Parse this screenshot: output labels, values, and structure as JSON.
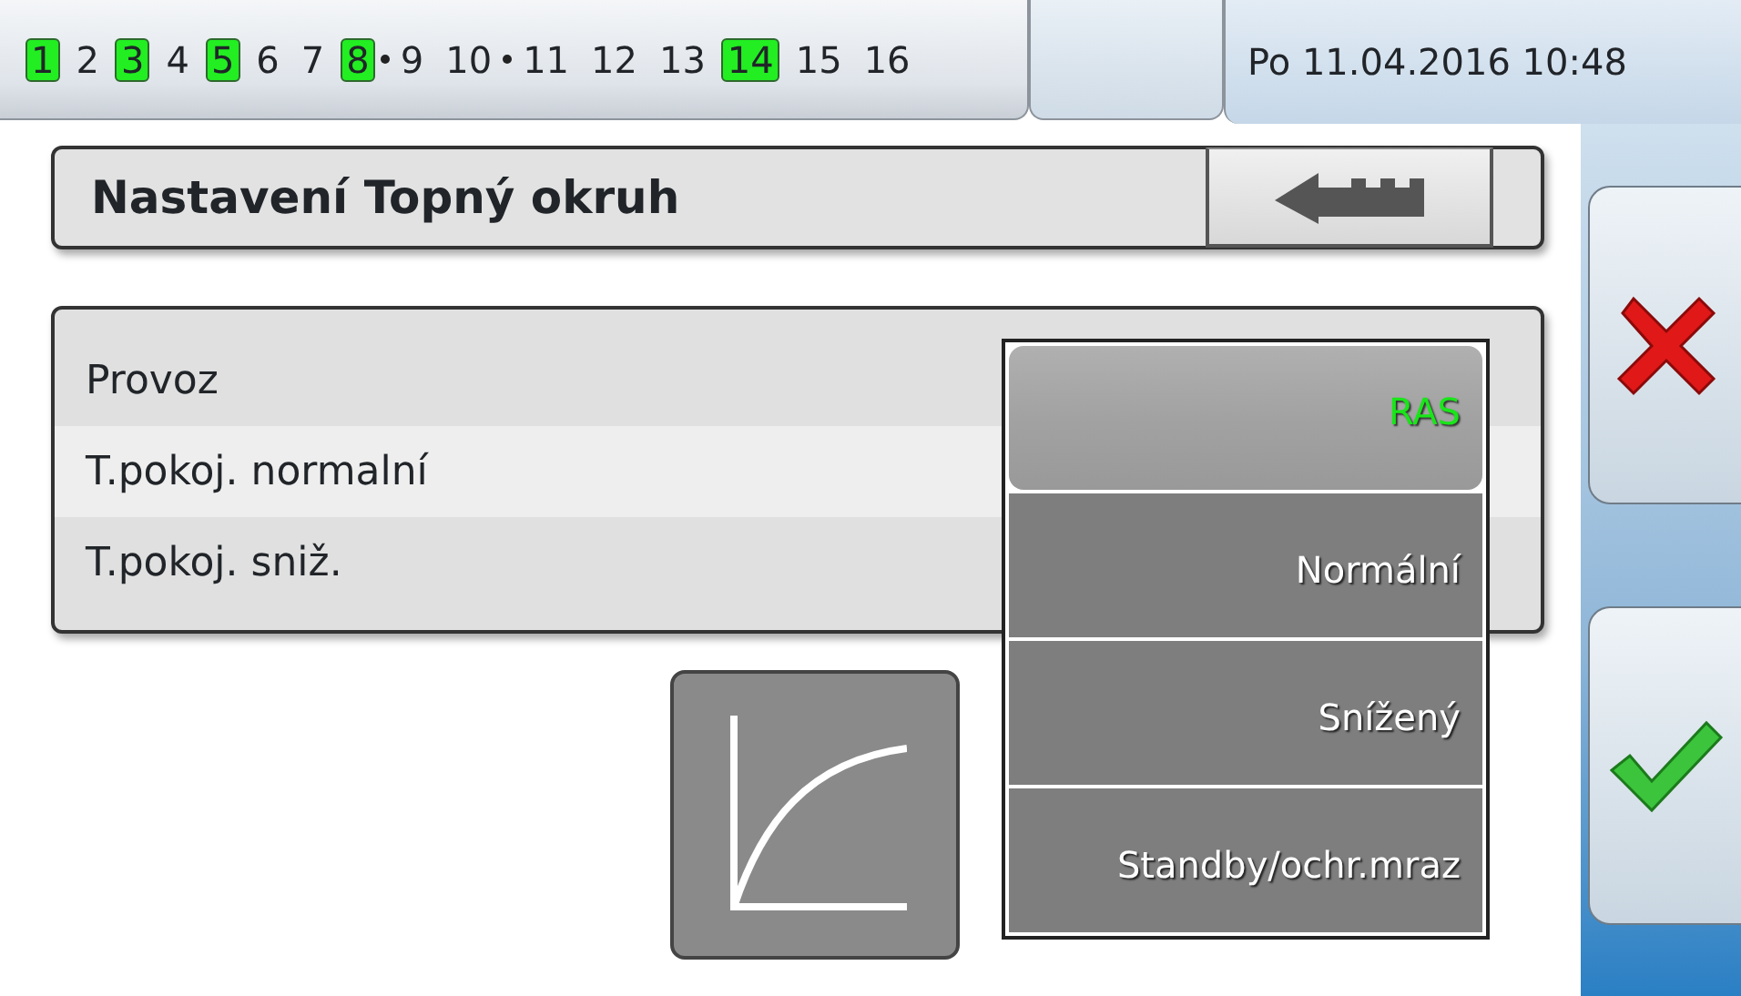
{
  "status_bar": {
    "outputs": [
      {
        "label": "1",
        "active": true,
        "link_next": false
      },
      {
        "label": "2",
        "active": false,
        "link_next": false
      },
      {
        "label": "3",
        "active": true,
        "link_next": false
      },
      {
        "label": "4",
        "active": false,
        "link_next": false
      },
      {
        "label": "5",
        "active": true,
        "link_next": false
      },
      {
        "label": "6",
        "active": false,
        "link_next": false
      },
      {
        "label": "7",
        "active": false,
        "link_next": false
      },
      {
        "label": "8",
        "active": true,
        "link_next": true
      },
      {
        "label": "9",
        "active": false,
        "link_next": false
      },
      {
        "label": "10",
        "active": false,
        "link_next": true
      },
      {
        "label": "11",
        "active": false,
        "link_next": false
      },
      {
        "label": "12",
        "active": false,
        "link_next": false
      },
      {
        "label": "13",
        "active": false,
        "link_next": false
      },
      {
        "label": "14",
        "active": true,
        "link_next": false
      },
      {
        "label": "15",
        "active": false,
        "link_next": false
      },
      {
        "label": "16",
        "active": false,
        "link_next": false
      }
    ],
    "datetime": "Po 11.04.2016 10:48"
  },
  "header": {
    "title": "Nastavení Topný okruh"
  },
  "settings": [
    {
      "label": "Provoz"
    },
    {
      "label": "T.pokoj. normalní"
    },
    {
      "label": "T.pokoj. sniž."
    }
  ],
  "dropdown": {
    "options": [
      {
        "label": "RAS",
        "selected": true
      },
      {
        "label": "Normální",
        "selected": false
      },
      {
        "label": "Snížený",
        "selected": false
      },
      {
        "label": "Standby/ochr.mraz",
        "selected": false
      }
    ]
  }
}
